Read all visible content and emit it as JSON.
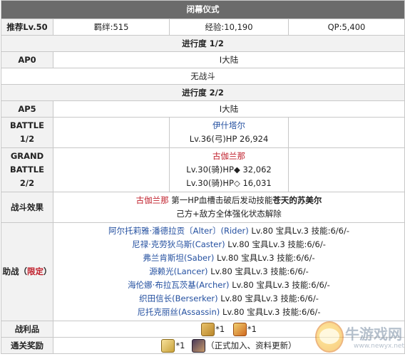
{
  "title": "闭幕仪式",
  "header": {
    "level_label": "推荐Lv.50",
    "bond": "羁绊:515",
    "exp": "经验:10,190",
    "qp": "QP:5,400"
  },
  "progress1": {
    "label": "进行度 1/2",
    "ap_label": "AP0",
    "ap_value": "I大陆",
    "no_battle": "无战斗"
  },
  "progress2": {
    "label": "进行度 2/2",
    "ap_label": "AP5",
    "ap_value": "I大陆",
    "battle1": {
      "label_line1": "BATTLE",
      "label_line2": "1/2",
      "enemy_name": "伊什塔尔",
      "enemy_info": "Lv.36(弓)HP 26,924"
    },
    "battle2": {
      "label_line1": "GRAND",
      "label_line2": "BATTLE",
      "label_line3": "2/2",
      "enemy_name": "古伽兰那",
      "enemy_info1": "Lv.30(骑)HP◆ 32,062",
      "enemy_info2": "Lv.30(骑)HP◇ 16,031"
    }
  },
  "battle_effect": {
    "label": "战斗效果",
    "enemy": "古伽兰那",
    "line1_mid": "第一HP血槽击破后发动技能",
    "line1_end": "苍天的苏美尔",
    "line2": "己方+敌方全体强化状态解除"
  },
  "support": {
    "label_main": "助战（",
    "label_limit": "限定",
    "label_close": "）",
    "entries": [
      {
        "name": "阿尔托莉雅·潘德拉贡〔Alter〕(Rider)",
        "info": "Lv.80 宝具Lv.3 技能:6/6/-"
      },
      {
        "name": "尼禄·克劳狄乌斯(Caster)",
        "info": "Lv.80 宝具Lv.3 技能:6/6/-"
      },
      {
        "name": "弗兰肯斯坦(Saber)",
        "info": "Lv.80 宝具Lv.3 技能:6/6/-"
      },
      {
        "name": "源赖光(Lancer)",
        "info": "Lv.80 宝具Lv.3 技能:6/6/-"
      },
      {
        "name": "海伦娜·布拉瓦茨基(Archer)",
        "info": "Lv.80 宝具Lv.3 技能:6/6/-"
      },
      {
        "name": "织田信长(Berserker)",
        "info": "Lv.80 宝具Lv.3 技能:6/6/-"
      },
      {
        "name": "尼托克丽丝(Assassin)",
        "info": "Lv.80 宝具Lv.3 技能:6/6/-"
      }
    ]
  },
  "spoils": {
    "label": "战利品",
    "item1_count": "*1",
    "item2_count": "*1",
    "icons": [
      "gold-gem-icon",
      "flame-icon"
    ]
  },
  "clear_reward": {
    "label": "通关奖励",
    "item1_count": "*1",
    "note": "（正式加入、资料更新）",
    "icons": [
      "trophy-icon",
      "servant-portrait-icon"
    ]
  },
  "watermark": {
    "text": "牛游戏网",
    "url": "www.newyx.net"
  }
}
